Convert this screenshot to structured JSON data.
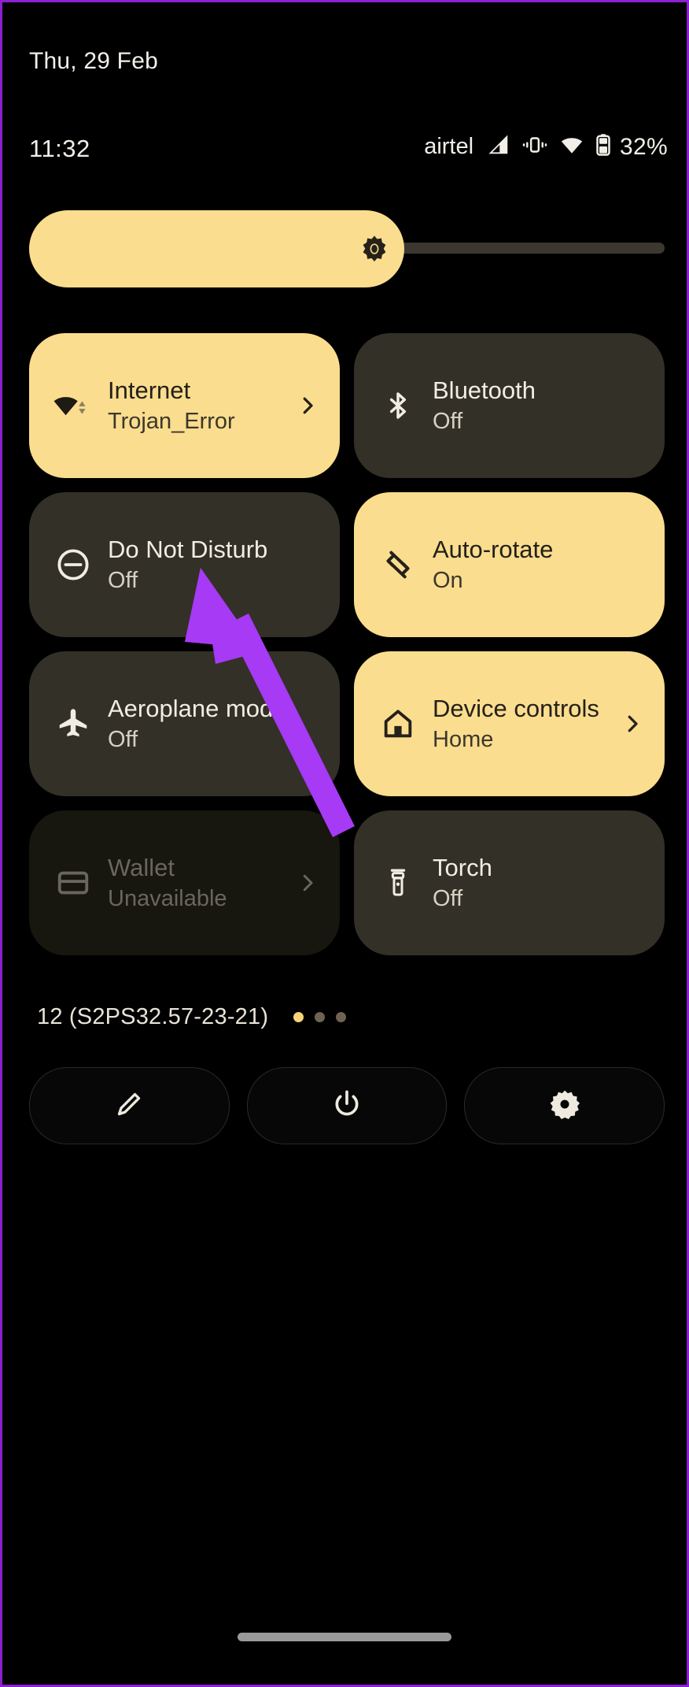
{
  "statusbar": {
    "date": "Thu, 29 Feb",
    "clock": "11:32",
    "carrier": "airtel",
    "battery_percent": "32%",
    "icons": [
      "signal-icon",
      "vibrate-icon",
      "wifi-icon",
      "battery-icon"
    ]
  },
  "brightness": {
    "icon": "brightness-icon",
    "level_percent": 59
  },
  "tiles": [
    {
      "name": "internet",
      "title": "Internet",
      "subtitle": "Trojan_Error",
      "state": "active",
      "icon": "wifi-icon",
      "chevron": true
    },
    {
      "name": "bluetooth",
      "title": "Bluetooth",
      "subtitle": "Off",
      "state": "inactive",
      "icon": "bluetooth-icon",
      "chevron": false
    },
    {
      "name": "do-not-disturb",
      "title": "Do Not Disturb",
      "subtitle": "Off",
      "state": "inactive",
      "icon": "dnd-icon",
      "chevron": false
    },
    {
      "name": "auto-rotate",
      "title": "Auto-rotate",
      "subtitle": "On",
      "state": "active",
      "icon": "rotate-icon",
      "chevron": false
    },
    {
      "name": "aeroplane-mode",
      "title": "Aeroplane mode",
      "subtitle": "Off",
      "state": "inactive",
      "icon": "airplane-icon",
      "chevron": false
    },
    {
      "name": "device-controls",
      "title": "Device controls",
      "subtitle": "Home",
      "state": "active",
      "icon": "home-icon",
      "chevron": true
    },
    {
      "name": "wallet",
      "title": "Wallet",
      "subtitle": "Unavailable",
      "state": "disabled",
      "icon": "wallet-icon",
      "chevron": true
    },
    {
      "name": "torch",
      "title": "Torch",
      "subtitle": "Off",
      "state": "inactive",
      "icon": "torch-icon",
      "chevron": false
    }
  ],
  "footer": {
    "build": "12 (S2PS32.57-23-21)",
    "pages": {
      "total": 3,
      "active_index": 0
    }
  },
  "actions": [
    {
      "name": "edit-button",
      "icon": "pencil-icon"
    },
    {
      "name": "power-button",
      "icon": "power-icon"
    },
    {
      "name": "settings-button",
      "icon": "gear-icon"
    }
  ],
  "annotation": {
    "type": "arrow",
    "color": "#A63AF5",
    "points_to": "do-not-disturb"
  },
  "colors": {
    "background": "#000000",
    "tile_active": "#FADD8E",
    "tile_inactive": "#333027",
    "tile_disabled": "#17160F",
    "accent_purple": "#A63AF5",
    "border_purple": "#8B1FD1"
  },
  "gesture_bar": {
    "name": "gesture-bar"
  }
}
